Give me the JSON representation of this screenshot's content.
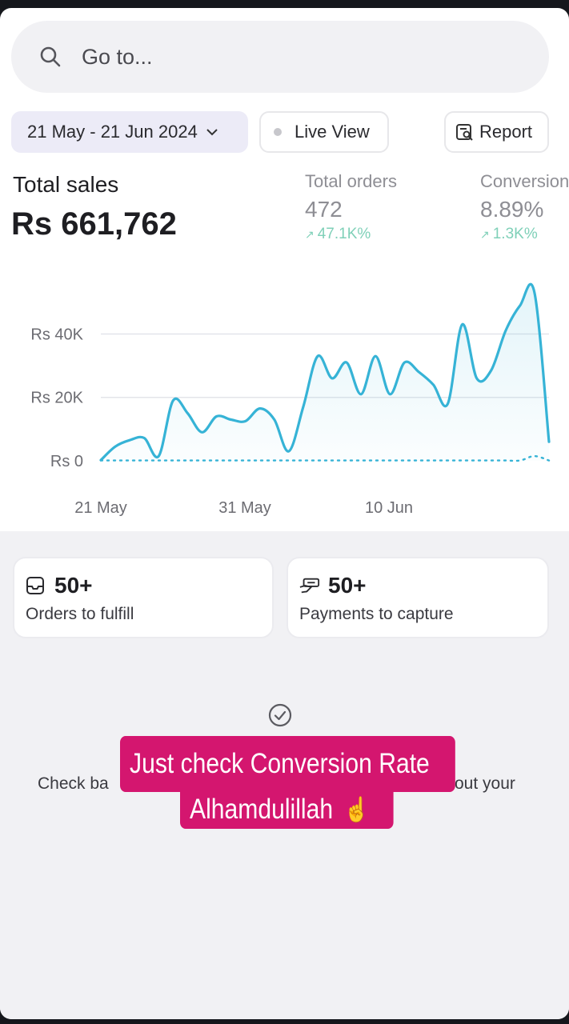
{
  "search": {
    "placeholder": "Go to..."
  },
  "toolbar": {
    "date_range": "21 May - 21 Jun 2024",
    "live_view": "Live View",
    "report": "Report"
  },
  "summary": {
    "total_sales_label": "Total sales",
    "total_sales_value": "Rs 661,762",
    "total_orders_label": "Total orders",
    "total_orders_value": "472",
    "total_orders_change": "47.1K%",
    "conversion_label": "Conversion",
    "conversion_value": "8.89%",
    "conversion_change": "1.3K%"
  },
  "chart_data": {
    "type": "line",
    "y_tick_labels": [
      "Rs 0",
      "Rs 20K",
      "Rs 40K"
    ],
    "x_tick_labels": [
      "21 May",
      "31 May",
      "10 Jun"
    ],
    "ylim": [
      0,
      55000
    ],
    "grid": true,
    "series": [
      {
        "color": "#36b3d6",
        "values": [
          200,
          4500,
          6500,
          7200,
          1500,
          19000,
          15000,
          9000,
          14000,
          13000,
          12500,
          16500,
          13000,
          3000,
          17000,
          33000,
          26000,
          31000,
          21000,
          33000,
          21000,
          31000,
          28000,
          24000,
          18000,
          43000,
          26000,
          28500,
          41000,
          49000,
          53000,
          6000
        ]
      },
      {
        "color": "#36b3d6",
        "style": "dotted",
        "values": [
          100,
          100,
          100,
          100,
          100,
          100,
          100,
          100,
          100,
          100,
          100,
          100,
          100,
          100,
          100,
          100,
          100,
          100,
          100,
          100,
          100,
          100,
          100,
          100,
          100,
          100,
          100,
          100,
          100,
          100,
          1500,
          100
        ]
      }
    ]
  },
  "tasks": {
    "orders_count": "50+",
    "orders_label": "Orders to fulfill",
    "payments_count": "50+",
    "payments_label": "Payments to capture"
  },
  "empty_state": {
    "text_left": "Check ba",
    "text_right": "out your"
  },
  "caption": {
    "line1": "Just check Conversion Rate",
    "line2": "Alhamdulillah",
    "emoji": "☝️"
  }
}
